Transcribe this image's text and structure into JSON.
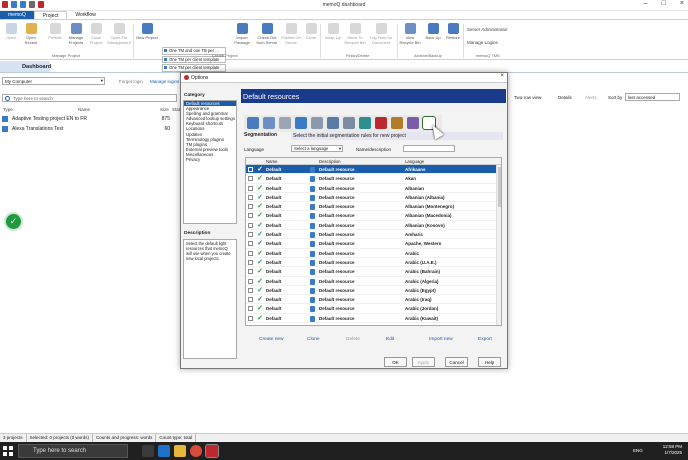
{
  "window": {
    "title": "memoQ dashboard"
  },
  "tabs": [
    "memoQ",
    "Project",
    "Workflow"
  ],
  "ribbon": {
    "buttons": [
      "Open",
      "Open Recent",
      "Presets",
      "Manage Projects",
      "Close Project",
      "Open For Management",
      "New Project",
      "Import Package",
      "Check Out from Server",
      "Publish On Server",
      "Clone",
      "Wrap Up",
      "Move To Recycle Bin",
      "Log Files for Document",
      "View Recycle Bin",
      "Back Up",
      "Restore"
    ],
    "tm_options": [
      "One TM and one TB per ...",
      "One TM per client template",
      "One TM per client template"
    ],
    "groups": [
      "Manage Project",
      "Create Project",
      "Finish/Delete",
      "Archive/Backup",
      "memoQ TMS"
    ],
    "side": [
      "Server Administrator",
      "Manage Logins"
    ]
  },
  "dashboard": {
    "tab": "Dashboard",
    "location": "My Computer",
    "links": [
      "Forget login",
      "Manage logins"
    ],
    "search_placeholder": "Type here to search",
    "columns": [
      "Type",
      "Name",
      "Size",
      "Stat"
    ],
    "projects": [
      {
        "name": "Adaptive Testing project EN to FR",
        "size": "875"
      },
      {
        "name": "Alexa Translations Test",
        "size": "60"
      }
    ],
    "right": {
      "view": "Two-row view",
      "details": "Details",
      "alerts": "Alerts",
      "sort_label": "Sort by",
      "sort_value": "last accessed"
    }
  },
  "status": [
    "3 projects",
    "Selected: 0 projects (0 words)",
    "Counts and progress: words",
    "Count type: total"
  ],
  "taskbar": {
    "search": "Type here to search",
    "time": "12:58 PM",
    "date": "1/7/2025",
    "lang": "ENG"
  },
  "dialog": {
    "title": "Options",
    "category_label": "Category",
    "categories": [
      "Default resources",
      "Appearance",
      "Spelling and grammar",
      "Advanced lookup settings",
      "Keyboard shortcuts",
      "Locations",
      "Updates",
      "Terminology plugins",
      "TM plugins",
      "External preview tools",
      "Miscellaneous",
      "Privacy"
    ],
    "description_label": "Description",
    "description": "Select the default light resources that memoQ will use when you create new local projects.",
    "header": "Default resources",
    "section": "Segmentation",
    "section_desc": "Select the initial segmentation rules for new project",
    "language_label": "Language",
    "language_select": "Select a language",
    "name_desc_label": "Name/description",
    "columns": [
      "Name",
      "Description",
      "Language"
    ],
    "rows": [
      {
        "name": "Default",
        "desc": "Default resource",
        "lang": "Afrikaans"
      },
      {
        "name": "Default",
        "desc": "Default resource",
        "lang": "Akan"
      },
      {
        "name": "Default",
        "desc": "Default resource",
        "lang": "Albanian"
      },
      {
        "name": "Default",
        "desc": "Default resource",
        "lang": "Albanian (Albania)"
      },
      {
        "name": "Default",
        "desc": "Default resource",
        "lang": "Albanian (Montenegro)"
      },
      {
        "name": "Default",
        "desc": "Default resource",
        "lang": "Albanian (Macedonia)"
      },
      {
        "name": "Default",
        "desc": "Default resource",
        "lang": "Albanian (Kosovo)"
      },
      {
        "name": "Default",
        "desc": "Default resource",
        "lang": "Amharic"
      },
      {
        "name": "Default",
        "desc": "Default resource",
        "lang": "Apache, Western"
      },
      {
        "name": "Default",
        "desc": "Default resource",
        "lang": "Arabic"
      },
      {
        "name": "Default",
        "desc": "Default resource",
        "lang": "Arabic (U.A.E.)"
      },
      {
        "name": "Default",
        "desc": "Default resource",
        "lang": "Arabic (Bahrain)"
      },
      {
        "name": "Default",
        "desc": "Default resource",
        "lang": "Arabic (Algeria)"
      },
      {
        "name": "Default",
        "desc": "Default resource",
        "lang": "Arabic (Egypt)"
      },
      {
        "name": "Default",
        "desc": "Default resource",
        "lang": "Arabic (Iraq)"
      },
      {
        "name": "Default",
        "desc": "Default resource",
        "lang": "Arabic (Jordan)"
      },
      {
        "name": "Default",
        "desc": "Default resource",
        "lang": "Arabic (Kuwait)"
      }
    ],
    "actions": [
      "Create new",
      "Clone",
      "Delete",
      "Edit",
      "Import new",
      "Export"
    ],
    "buttons": [
      "OK",
      "Apply",
      "Cancel",
      "Help"
    ]
  }
}
